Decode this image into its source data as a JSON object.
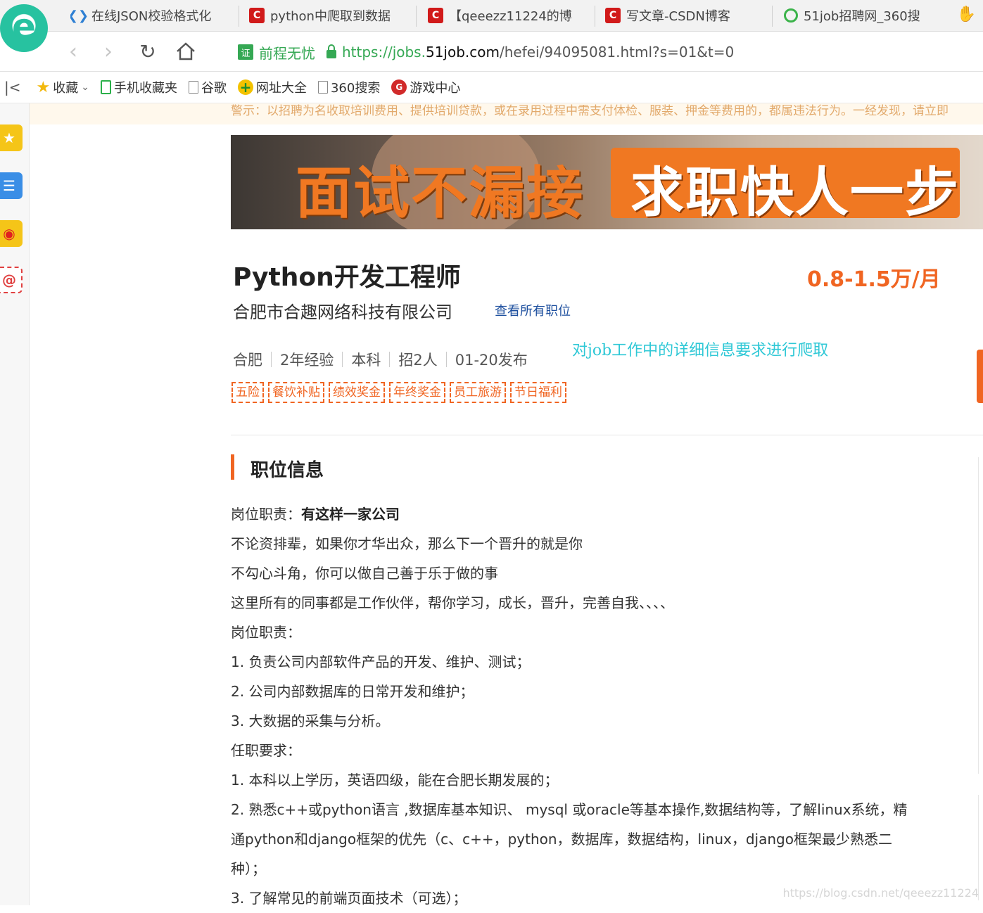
{
  "browser": {
    "tabs": [
      {
        "label": "在线JSON校验格式化",
        "icon": "json-icon"
      },
      {
        "label": "python中爬取到数据",
        "icon": "csdn-icon"
      },
      {
        "label": "【qeeezz11224的博",
        "icon": "csdn-icon"
      },
      {
        "label": "写文章-CSDN博客",
        "icon": "csdn-icon"
      },
      {
        "label": "51job招聘网_360搜",
        "icon": "so360-icon"
      }
    ],
    "address": {
      "cert_label": "证",
      "site_name": "前程无忧",
      "url_scheme": "https://jobs.",
      "url_domain": "51job.com",
      "url_path": "/hefei/94095081.html?s=01&t=0"
    },
    "bookmarks": [
      {
        "label": "收藏",
        "icon": "star-icon"
      },
      {
        "label": "手机收藏夹",
        "icon": "phone-icon"
      },
      {
        "label": "谷歌",
        "icon": "page-icon"
      },
      {
        "label": "网址大全",
        "icon": "plus-icon"
      },
      {
        "label": "360搜索",
        "icon": "page-icon"
      },
      {
        "label": "游戏中心",
        "icon": "game-icon"
      }
    ]
  },
  "page": {
    "warning": "警示：以招聘为名收取培训费用、提供培训贷款，或在录用过程中需支付体检、服装、押金等费用的，都属违法行为。一经发现，请立即",
    "banner": {
      "left": "面试不漏接",
      "right": "求职快人一步"
    },
    "job_title": "Python开发工程师",
    "salary": "0.8-1.5万/月",
    "company": "合肥市合趣网络科技有限公司",
    "all_jobs_link": "查看所有职位",
    "annotation": "对job工作中的详细信息要求进行爬取",
    "meta": [
      "合肥",
      "2年经验",
      "本科",
      "招2人",
      "01-20发布"
    ],
    "tags": [
      "五险",
      "餐饮补贴",
      "绩效奖金",
      "年终奖金",
      "员工旅游",
      "节日福利"
    ],
    "section_title": "职位信息",
    "description": {
      "first_prefix": "岗位职责：",
      "first_bold": "有这样一家公司",
      "lines": [
        "不论资排辈，如果你才华出众，那么下一个晋升的就是你",
        "不勾心斗角，你可以做自己善于乐于做的事",
        "这里所有的同事都是工作伙伴，帮你学习，成长，晋升，完善自我、、、、",
        "岗位职责：",
        "1. 负责公司内部软件产品的开发、维护、测试；",
        "2. 公司内部数据库的日常开发和维护；",
        "3. 大数据的采集与分析。",
        "任职要求：",
        "1. 本科以上学历，英语四级，能在合肥长期发展的；",
        "2. 熟悉c++或python语言 ,数据库基本知识、 mysql 或oracle等基本操作,数据结构等，了解linux系统，精",
        "通python和django框架的优先（c、c++，python，数据库，数据结构，linux，django框架最少熟悉二",
        "种）；",
        "3. 了解常见的前端页面技术（可选）；"
      ]
    },
    "watermark": "https://blog.csdn.net/qeeezz11224"
  },
  "colors": {
    "accent": "#f06522",
    "link": "#1d4f9e",
    "secure": "#35a854",
    "annotation": "#2fc8d6"
  }
}
